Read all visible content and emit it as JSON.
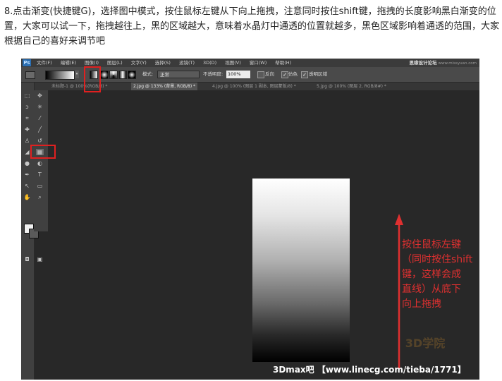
{
  "instruction": "8.点击渐变(快捷键G)，选择图中模式，按住鼠标左键从下向上拖拽，注意同时按住shift键，拖拽的长度影响黑白渐变的位置，大家可以试一下，拖拽越往上，黑的区域越大，意味着水晶灯中通透的位置就越多，黑色区域影响着通透的范围，大家根据自己的喜好来调节吧",
  "app": {
    "logo": "Ps"
  },
  "menu": [
    "文件(F)",
    "编辑(E)",
    "图像(I)",
    "图层(L)",
    "文字(Y)",
    "选择(S)",
    "滤镜(T)",
    "3D(D)",
    "视图(V)",
    "窗口(W)",
    "帮助(H)"
  ],
  "brand": {
    "name": "思缘设计论坛",
    "url": "www.missyuan.com"
  },
  "options": {
    "mode_label": "模式:",
    "mode_value": "正常",
    "opacity_label": "不透明度:",
    "opacity_value": "100%",
    "reverse_label": "反向",
    "dither_label": "仿色",
    "transparency_label": "透明区域",
    "reverse_checked": false,
    "dither_checked": true,
    "transparency_checked": true
  },
  "tabs": [
    {
      "label": "未标题-1 @ 100%(RGB/8) *",
      "active": false
    },
    {
      "label": "2.jpg @ 133% (背景, RGB/8) *",
      "active": true
    },
    {
      "label": "4.jpg @ 100% (图层 1 副本, 图层蒙版/8) *",
      "active": false
    },
    {
      "label": "5.jpg @ 100% (图层 2, RGB/8#) *",
      "active": false
    }
  ],
  "annotation": "按住鼠标左键\n（同时按住shift\n键，这样会成\n直线）从底下\n向上拖拽",
  "watermark": "3D学院",
  "footer": "3Dmax吧 【www.linecg.com/tieba/1771】",
  "colors": {
    "annotation_red": "#e03030",
    "highlight_red": "#e02020",
    "ps_blue": "#2b6fb3"
  }
}
